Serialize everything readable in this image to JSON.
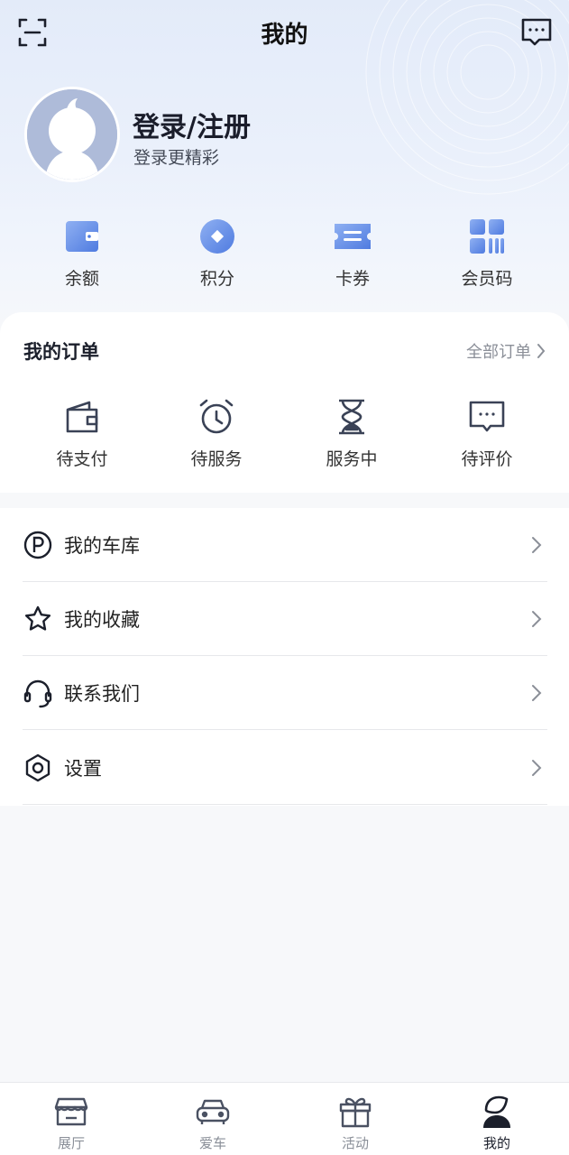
{
  "header": {
    "title": "我的",
    "scan_icon": "scan-icon",
    "message_icon": "message-icon"
  },
  "profile": {
    "title": "登录/注册",
    "subtitle": "登录更精彩",
    "avatar_icon": "avatar-placeholder-icon"
  },
  "assets": [
    {
      "label": "余额",
      "icon": "wallet-icon"
    },
    {
      "label": "积分",
      "icon": "points-coin-icon"
    },
    {
      "label": "卡券",
      "icon": "coupon-icon"
    },
    {
      "label": "会员码",
      "icon": "member-code-icon"
    }
  ],
  "orders": {
    "title": "我的订单",
    "all_label": "全部订单",
    "items": [
      {
        "label": "待支付",
        "icon": "wallet-outline-icon"
      },
      {
        "label": "待服务",
        "icon": "alarm-clock-icon"
      },
      {
        "label": "服务中",
        "icon": "hourglass-icon"
      },
      {
        "label": "待评价",
        "icon": "comment-icon"
      }
    ]
  },
  "menu": [
    {
      "label": "我的车库",
      "icon": "parking-icon"
    },
    {
      "label": "我的收藏",
      "icon": "star-icon"
    },
    {
      "label": "联系我们",
      "icon": "headset-icon"
    },
    {
      "label": "设置",
      "icon": "hexagon-settings-icon"
    }
  ],
  "tabbar": [
    {
      "label": "展厅",
      "icon": "showroom-icon",
      "active": false
    },
    {
      "label": "爱车",
      "icon": "car-icon",
      "active": false
    },
    {
      "label": "活动",
      "icon": "gift-icon",
      "active": false
    },
    {
      "label": "我的",
      "icon": "profile-icon",
      "active": true
    }
  ],
  "colors": {
    "accent": "#4f7be0",
    "icon_dark": "#3a4256",
    "text_muted": "#8b8f98"
  }
}
